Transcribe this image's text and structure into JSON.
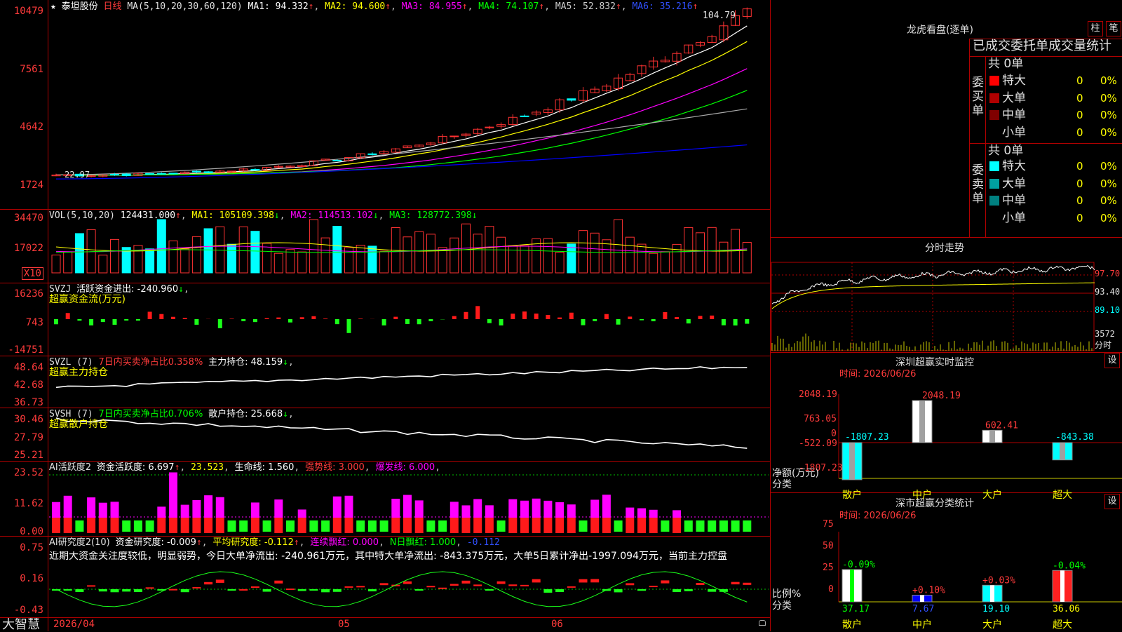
{
  "stock": {
    "star": "★",
    "name": "泰坦股份",
    "period": "日线"
  },
  "main": {
    "ma_label": "MA(5,10,20,30,60,120)",
    "ma1": "MA1: 94.332",
    "ma2": "MA2: 94.600",
    "ma3": "MA3: 84.955",
    "ma4": "MA4: 74.107",
    "ma5": "MA5: 52.832",
    "ma6": "MA6: 35.216",
    "axis": [
      "10479",
      "7561",
      "4642",
      "1724"
    ],
    "high_label": "104.79",
    "low_label": "22.97"
  },
  "vol": {
    "label": "VOL(5,10,20)",
    "value": "124431.000",
    "ma1": "MA1: 105109.398",
    "ma2": "MA2: 114513.102",
    "ma3": "MA3: 128772.398",
    "axis": [
      "34470",
      "17022"
    ],
    "unit": "X10"
  },
  "svzj": {
    "label": "SVZJ",
    "title": "活跃资金进出: -240.960",
    "sub": "超赢资金流(万元)",
    "axis": [
      "16236",
      "743",
      "-14751"
    ]
  },
  "svzl": {
    "label": "SVZL (7)",
    "ratio": "7日内买卖净占比0.358%",
    "hold": "主力持仓: 48.159",
    "sub": "超赢主力持仓",
    "axis": [
      "48.64",
      "42.68",
      "36.73"
    ]
  },
  "svsh": {
    "label": "SVSH (7)",
    "ratio": "7日内买卖净占比0.706%",
    "hold": "散户持仓: 25.668",
    "sub": "超赢散户持仓",
    "axis": [
      "30.46",
      "27.79",
      "25.21"
    ]
  },
  "ai1": {
    "label": "AI活跃度2",
    "active": "资金活跃度: 6.697",
    "v2": "23.523",
    "life": "生命线: 1.560",
    "strong": "强势线: 3.000",
    "burst": "爆发线: 6.000",
    "axis": [
      "23.52",
      "11.62",
      "0.00"
    ]
  },
  "ai2": {
    "label": "AI研究度2(10)",
    "research": "资金研究度: -0.009",
    "avg": "平均研究度: -0.112",
    "red": "连续飘红: 0.000",
    "nred": "N日飘红: 1.000",
    "neg": "-0.112",
    "axis": [
      "0.75",
      "0.16",
      "-0.43"
    ],
    "comment": "近期大资金关注度较低，明显弱势，今日大单净流出: -240.961万元，其中特大单净流出: -843.375万元，大单5日累计净出-1997.094万元，当前主力控盘"
  },
  "dates": {
    "d1": "2026/04",
    "d2": "05",
    "d3": "06"
  },
  "brand": "大智慧",
  "lhb": {
    "title": "龙虎看盘(逐单)",
    "btn1": "柱",
    "btn2": "笔",
    "header": "已成交委托单成交量统计",
    "buy_label": "委买单",
    "sell_label": "委卖单",
    "buy_total": "共 0单",
    "sell_total": "共 0单",
    "buy_rows": [
      {
        "name": "特大",
        "count": "0",
        "pct": "0%",
        "color": "#ff0000"
      },
      {
        "name": "大单",
        "count": "0",
        "pct": "0%",
        "color": "#b00000"
      },
      {
        "name": "中单",
        "count": "0",
        "pct": "0%",
        "color": "#800000"
      },
      {
        "name": "小单",
        "count": "0",
        "pct": "0%",
        "color": "#000000"
      }
    ],
    "sell_rows": [
      {
        "name": "特大",
        "count": "0",
        "pct": "0%",
        "color": "#00ffff"
      },
      {
        "name": "大单",
        "count": "0",
        "pct": "0%",
        "color": "#00a0a0"
      },
      {
        "name": "中单",
        "count": "0",
        "pct": "0%",
        "color": "#008080"
      },
      {
        "name": "小单",
        "count": "0",
        "pct": "0%",
        "color": "#000000"
      }
    ]
  },
  "fenshi": {
    "title": "分时走势",
    "axis": [
      "97.70",
      "93.40",
      "89.10",
      "3572",
      "分时"
    ]
  },
  "monitor": {
    "title": "深圳超赢实时监控",
    "btn": "设",
    "time": "时间: 2026/06/26",
    "axis": [
      "2048.19",
      "763.05",
      "0",
      "-522.09",
      "-1807.23"
    ],
    "ylabel": "净额(万元)",
    "xlabel": "分类",
    "cats": [
      "散户",
      "中户",
      "大户",
      "超大"
    ],
    "values": [
      -1807.23,
      2048.19,
      602.41,
      -843.38
    ],
    "labels": [
      "-1807.23",
      "2048.19",
      "602.41",
      "-843.38"
    ]
  },
  "classify": {
    "title": "深市超赢分类统计",
    "btn": "设",
    "time": "时间: 2026/06/26",
    "axis": [
      "75",
      "50",
      "25",
      "0"
    ],
    "ylabel": "比例%",
    "xlabel": "分类",
    "cats": [
      "散户",
      "中户",
      "大户",
      "超大"
    ],
    "values": [
      37.17,
      7.67,
      19.1,
      36.06
    ],
    "bottom": [
      "37.17",
      "7.67",
      "19.10",
      "36.06"
    ],
    "changes": [
      "-0.09%",
      "+0.10%",
      "+0.03%",
      "-0.04%"
    ]
  },
  "colors": {
    "up": "#ff3232",
    "down": "#00ffff",
    "grid": "#b00000",
    "ma1": "#ffffff",
    "ma2": "#ffff00",
    "ma3": "#ff00ff",
    "ma4": "#00ff00",
    "ma5": "#aaaaaa",
    "ma6": "#0000ff"
  }
}
